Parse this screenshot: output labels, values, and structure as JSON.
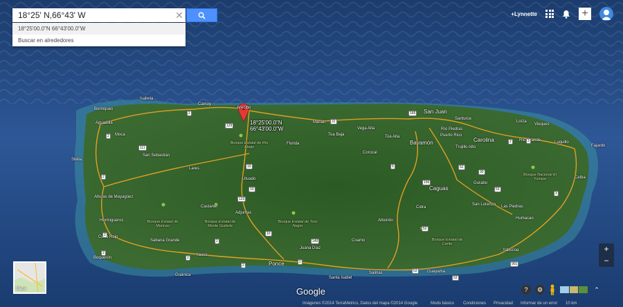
{
  "search": {
    "value": "18°25' N,66°43' W",
    "suggestions": [
      "18°25'00.0\"N 66°43'00.0\"W",
      "Buscar en alrededores"
    ]
  },
  "topbar": {
    "user": "+Lynnette"
  },
  "pin": {
    "lat": "18°25'00.0\"N",
    "lng": "66°43'00.0\"W"
  },
  "places": [
    {
      "name": "Isabela",
      "big": false
    },
    {
      "name": "Borinquen",
      "big": false
    },
    {
      "name": "Aguadilla",
      "big": false
    },
    {
      "name": "Moca",
      "big": false
    },
    {
      "name": "Camuy",
      "big": false
    },
    {
      "name": "Arecibo",
      "big": false
    },
    {
      "name": "Manatí",
      "big": false
    },
    {
      "name": "San Juan",
      "big": true
    },
    {
      "name": "Vega Alta",
      "big": false
    },
    {
      "name": "Toa Baja",
      "big": false
    },
    {
      "name": "Toa Alta",
      "big": false
    },
    {
      "name": "Bayamón",
      "big": true
    },
    {
      "name": "Río Piedras",
      "big": false
    },
    {
      "name": "Puerto Rico",
      "big": false
    },
    {
      "name": "Santurce",
      "big": false
    },
    {
      "name": "Carolina",
      "big": true
    },
    {
      "name": "Loíza",
      "big": false
    },
    {
      "name": "Vieques",
      "big": false
    },
    {
      "name": "Río Grande",
      "big": false
    },
    {
      "name": "Luquillo",
      "big": false
    },
    {
      "name": "Fajardo",
      "big": false
    },
    {
      "name": "Ceiba",
      "big": false
    },
    {
      "name": "Trujillo Alto",
      "big": false
    },
    {
      "name": "Florida",
      "big": false
    },
    {
      "name": "Corozal",
      "big": false
    },
    {
      "name": "Stella",
      "big": false
    },
    {
      "name": "San Sebastián",
      "big": false
    },
    {
      "name": "Lares",
      "big": false
    },
    {
      "name": "Utuado",
      "big": false
    },
    {
      "name": "Alturas de Mayagüez",
      "big": false
    },
    {
      "name": "Castaner",
      "big": false
    },
    {
      "name": "Adjuntas",
      "big": false
    },
    {
      "name": "Hormigueros",
      "big": false
    },
    {
      "name": "Cabo Rojo",
      "big": false
    },
    {
      "name": "Sabana Grande",
      "big": false
    },
    {
      "name": "Boquerón",
      "big": false
    },
    {
      "name": "Yauco",
      "big": false
    },
    {
      "name": "Guánica",
      "big": false
    },
    {
      "name": "Ponce",
      "big": true
    },
    {
      "name": "Juana Díaz",
      "big": false
    },
    {
      "name": "Coamo",
      "big": false
    },
    {
      "name": "Aibonito",
      "big": false
    },
    {
      "name": "Cidra",
      "big": false
    },
    {
      "name": "Caguas",
      "big": true
    },
    {
      "name": "Gurabo",
      "big": false
    },
    {
      "name": "San Lorenzo",
      "big": false
    },
    {
      "name": "Las Piedras",
      "big": false
    },
    {
      "name": "Humacao",
      "big": false
    },
    {
      "name": "Yabucoa",
      "big": false
    },
    {
      "name": "Guayama",
      "big": false
    },
    {
      "name": "Santa Isabel",
      "big": false
    },
    {
      "name": "Salinas",
      "big": false
    }
  ],
  "parks": [
    "Bosque Estatal de Río Abajo",
    "Bosque Estatal de Maricao",
    "Bosque Estatal de Monte Guilarte",
    "Bosque Estatal de Toro Negro",
    "Bosque Nacional El Yunque",
    "Bosque Estatal de Carite"
  ],
  "shields": [
    "2",
    "2",
    "129",
    "10",
    "10",
    "22",
    "165",
    "2",
    "5",
    "111",
    "2",
    "2",
    "2",
    "10",
    "123",
    "52",
    "52",
    "149",
    "156",
    "30",
    "53",
    "3",
    "3",
    "53",
    "901",
    "53",
    "2",
    "2",
    "2",
    "2"
  ],
  "minimap": {
    "label": "Mapa"
  },
  "attribution": {
    "logo": "Google",
    "copyright": "Imágenes ©2014 TerraMetrics, Datos del mapa ©2014 Google",
    "mode": "Modo básico",
    "terms": "Condiciones",
    "privacy": "Privacidad",
    "report": "Informar de un error",
    "scale": "10 km"
  },
  "colors": {
    "search_button": "#4d90fe",
    "pin": "#e53935",
    "road": "#f5a623",
    "ocean": "#173561",
    "land": "#2e5a27"
  }
}
